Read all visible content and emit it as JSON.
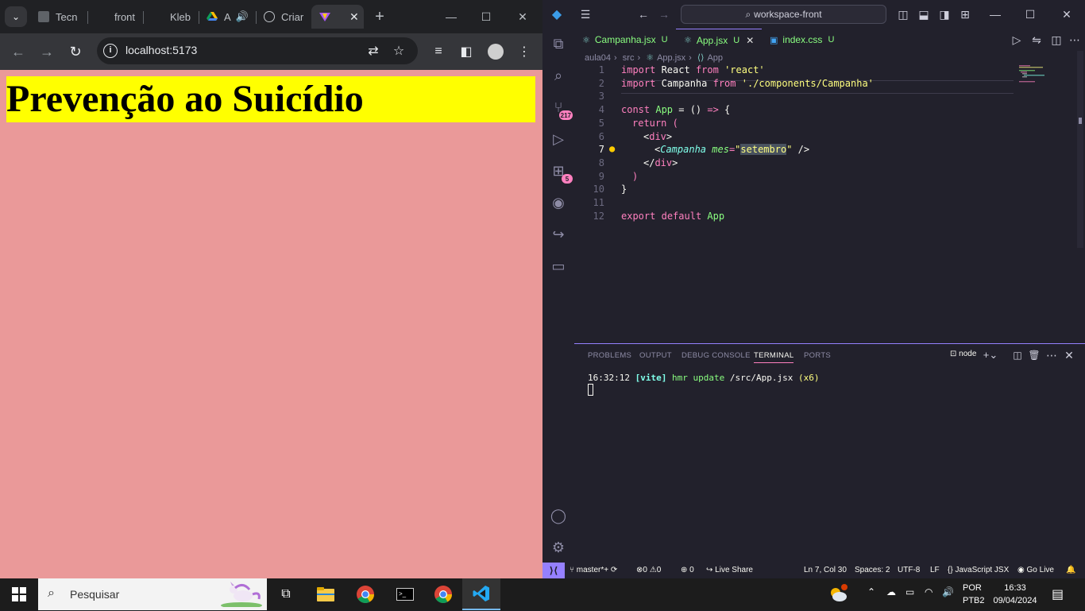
{
  "browser": {
    "tabs": [
      {
        "label": "Tecn"
      },
      {
        "label": "front"
      },
      {
        "label": "Kleb"
      },
      {
        "label": "A"
      },
      {
        "label": "Criar"
      },
      {
        "label": ""
      }
    ],
    "url": "localhost:5173",
    "page_heading": "Prevenção ao Suicídio",
    "page_bg": "#ea9999",
    "heading_bg": "#ffff00"
  },
  "vscode": {
    "command_center": "workspace-front",
    "editor_tabs": [
      {
        "label": "Campanha.jsx",
        "status": "U"
      },
      {
        "label": "App.jsx",
        "status": "U"
      },
      {
        "label": "index.css",
        "status": "U"
      }
    ],
    "breadcrumb": [
      "aula04",
      "src",
      "App.jsx",
      "App"
    ],
    "code_lines": [
      {
        "n": "1"
      },
      {
        "n": "2"
      },
      {
        "n": "3"
      },
      {
        "n": "4"
      },
      {
        "n": "5"
      },
      {
        "n": "6"
      },
      {
        "n": "7"
      },
      {
        "n": "8"
      },
      {
        "n": "9"
      },
      {
        "n": "10"
      },
      {
        "n": "11"
      },
      {
        "n": "12"
      }
    ],
    "code": {
      "l1": [
        "import",
        " React ",
        "from",
        " 'react'"
      ],
      "l2": [
        "import",
        " Campanha ",
        "from",
        " './components/Campanha'"
      ],
      "l4": [
        "const",
        " App ",
        "= () ",
        "=>",
        " {"
      ],
      "l5": [
        "return",
        " ("
      ],
      "l6": [
        "<",
        "div",
        ">"
      ],
      "l7": [
        "<",
        "Campanha",
        " mes",
        "=",
        "\"",
        "setembro",
        "\"",
        " />"
      ],
      "l8": [
        "</",
        "div",
        ">"
      ],
      "l9": [
        ")"
      ],
      "l10": [
        "}"
      ],
      "l12": [
        "export",
        " ",
        "default",
        " App"
      ]
    },
    "activity_badges": {
      "source_control": "217",
      "extensions": "5"
    },
    "panel_tabs": [
      "PROBLEMS",
      "OUTPUT",
      "DEBUG CONSOLE",
      "TERMINAL",
      "PORTS"
    ],
    "terminal_shell": "node",
    "terminal_line": {
      "time": "16:32:12",
      "tag": "[vite]",
      "msg": "hmr update",
      "path": "/src/App.jsx",
      "count": "(x6)"
    },
    "status": {
      "branch": "master*+",
      "errors": "0",
      "warnings": "0",
      "ports": "0",
      "live_share": "Live Share",
      "position": "Ln 7, Col 30",
      "spaces": "Spaces: 2",
      "encoding": "UTF-8",
      "eol": "LF",
      "language": "JavaScript JSX",
      "go_live": "Go Live"
    }
  },
  "taskbar": {
    "search_placeholder": "Pesquisar",
    "lang": "POR",
    "layout": "PTB2",
    "time": "16:33",
    "date": "09/04/2024"
  }
}
